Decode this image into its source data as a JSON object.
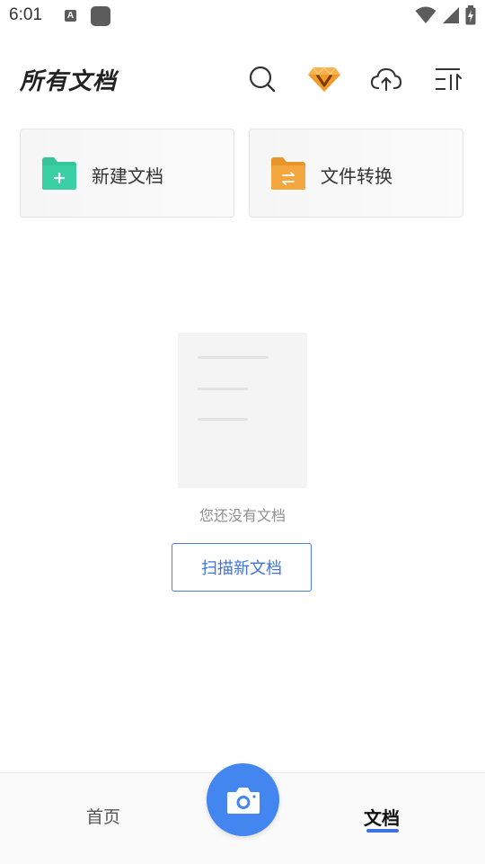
{
  "status_bar": {
    "time": "6:01",
    "a_badge": "A",
    "icons": [
      "wifi-icon",
      "cell-signal-icon",
      "battery-charging-icon"
    ]
  },
  "header": {
    "title": "所有文档",
    "actions": [
      "search-icon",
      "vip-diamond-icon",
      "cloud-upload-icon",
      "sort-icon"
    ]
  },
  "cards": {
    "new_doc": {
      "label": "新建文档",
      "icon": "folder-add-icon",
      "color": "#35c59b"
    },
    "convert": {
      "label": "文件转换",
      "icon": "folder-convert-icon",
      "color": "#f2a23a"
    }
  },
  "empty_state": {
    "message": "您还没有文档",
    "button_label": "扫描新文档"
  },
  "bottom_nav": {
    "home_label": "首页",
    "docs_label": "文档",
    "active_tab": "文档",
    "fab_icon": "camera-icon"
  },
  "colors": {
    "accent": "#3f74e0",
    "fab": "#4486f0",
    "diamond": "#f2a23a"
  }
}
